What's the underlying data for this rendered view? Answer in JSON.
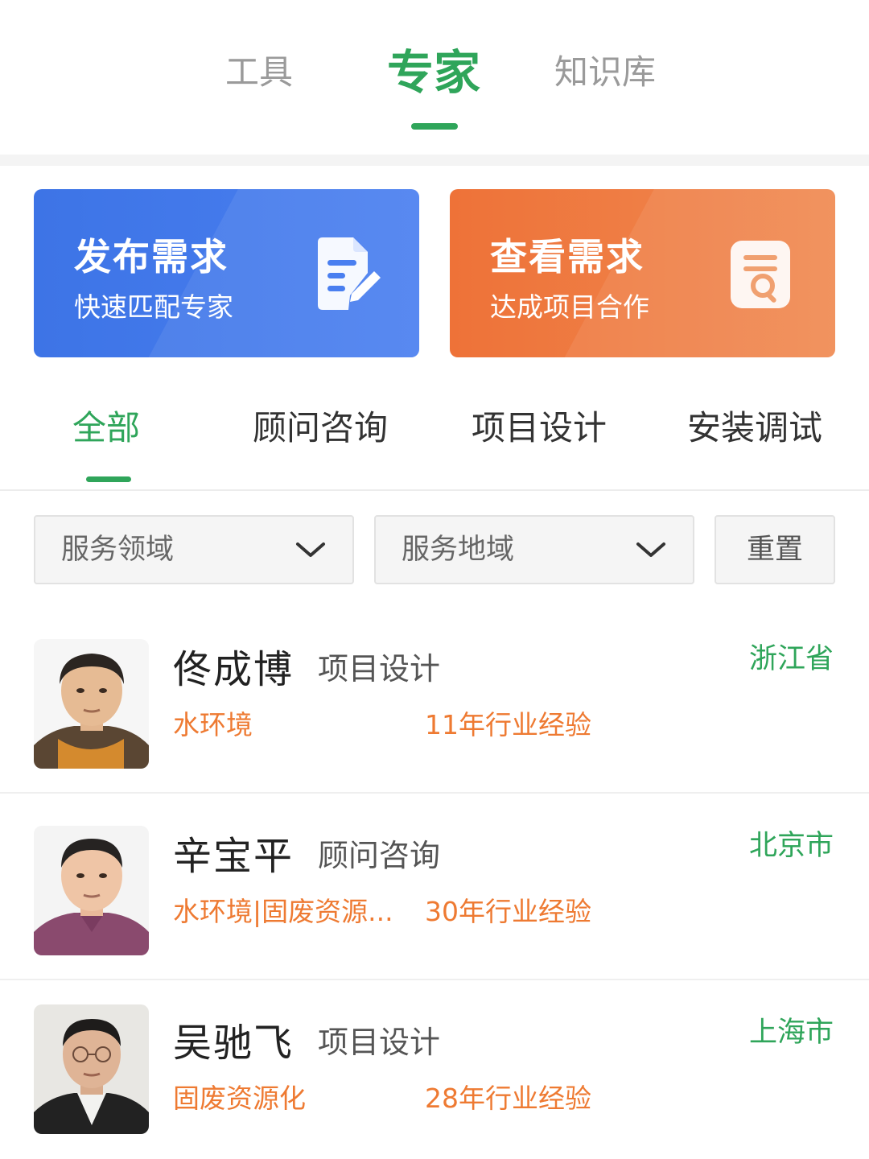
{
  "top_tabs": [
    {
      "label": "工具"
    },
    {
      "label": "专家"
    },
    {
      "label": "知识库"
    }
  ],
  "active_top_tab": "专家",
  "banners": {
    "publish": {
      "title": "发布需求",
      "subtitle": "快速匹配专家",
      "icon": "edit-document-icon",
      "color": "#4a7ff0"
    },
    "view": {
      "title": "查看需求",
      "subtitle": "达成项目合作",
      "icon": "search-document-icon",
      "color": "#ee7a3e"
    }
  },
  "category_tabs": [
    {
      "label": "全部"
    },
    {
      "label": "顾问咨询"
    },
    {
      "label": "项目设计"
    },
    {
      "label": "安装调试"
    }
  ],
  "active_category": "全部",
  "filters": {
    "service_field": {
      "label": "服务领域",
      "icon": "chevron-down-icon"
    },
    "service_region": {
      "label": "服务地域",
      "icon": "chevron-down-icon"
    },
    "reset_label": "重置"
  },
  "experts": [
    {
      "name": "佟成博",
      "role": "项目设计",
      "region": "浙江省",
      "field": "水环境",
      "years": "11年行业经验"
    },
    {
      "name": "辛宝平",
      "role": "顾问咨询",
      "region": "北京市",
      "field": "水环境|固废资源...",
      "years": "30年行业经验"
    },
    {
      "name": "吴驰飞",
      "role": "项目设计",
      "region": "上海市",
      "field": "固废资源化",
      "years": "28年行业经验"
    }
  ],
  "colors": {
    "accent": "#2fa55a",
    "orange_text": "#ee7a32",
    "blue_card": "#4a7ff0",
    "orange_card": "#ee7a3e"
  }
}
